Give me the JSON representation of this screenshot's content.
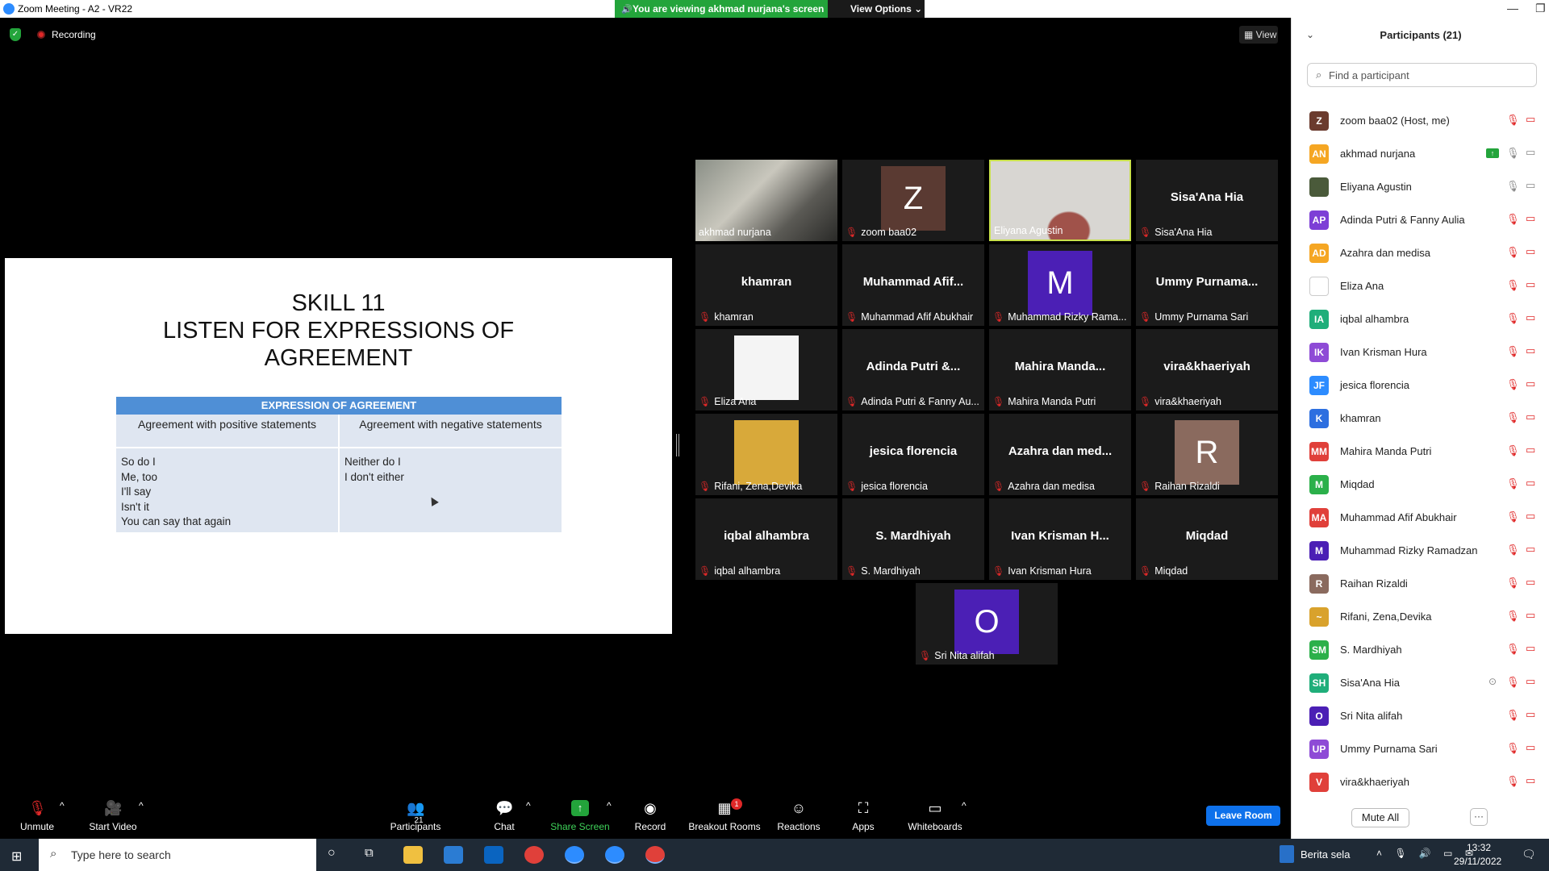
{
  "window": {
    "title": "Zoom Meeting - A2 - VR22",
    "banner": "You are viewing akhmad nurjana's screen",
    "view_options": "View Options ⌄",
    "controls": [
      "—",
      "❐",
      "✕"
    ]
  },
  "meeting": {
    "recording_label": "Recording",
    "view_label": "View"
  },
  "slide": {
    "title_line1": "SKILL 11",
    "title_line2": "LISTEN FOR EXPRESSIONS OF",
    "title_line3": "AGREEMENT",
    "table_header": "EXPRESSION OF AGREEMENT",
    "col1_header": "Agreement with positive statements",
    "col2_header": "Agreement with negative statements",
    "col1_items": [
      "So do I",
      "Me, too",
      "I'll say",
      "Isn't it",
      "You can say that again"
    ],
    "col2_items": [
      "Neither do I",
      "I don't either"
    ]
  },
  "gallery": [
    {
      "label": "akhmad nurjana",
      "type": "photo",
      "muted": false
    },
    {
      "label": "zoom baa02",
      "type": "avatar",
      "initial": "Z",
      "color": "#5a3a32",
      "muted": true
    },
    {
      "label": "Eliyana Agustin",
      "type": "photo",
      "muted": false,
      "speaking": true
    },
    {
      "label": "Sisa'Ana Hia",
      "type": "name",
      "display": "Sisa'Ana Hia",
      "muted": true
    },
    {
      "label": "khamran",
      "type": "name",
      "display": "khamran",
      "muted": true
    },
    {
      "label": "Muhammad Afif Abukhair",
      "type": "name",
      "display": "Muhammad Afif...",
      "muted": true
    },
    {
      "label": "Muhammad Rizky Rama...",
      "type": "avatar",
      "initial": "M",
      "color": "#4b1fb5",
      "muted": true
    },
    {
      "label": "Ummy Purnama Sari",
      "type": "name",
      "display": "Ummy Purnama...",
      "muted": true
    },
    {
      "label": "Eliza Ana",
      "type": "photo",
      "muted": true
    },
    {
      "label": "Adinda Putri & Fanny Au...",
      "type": "name",
      "display": "Adinda Putri &...",
      "muted": true
    },
    {
      "label": "Mahira Manda Putri",
      "type": "name",
      "display": "Mahira Manda...",
      "muted": true
    },
    {
      "label": "vira&khaeriyah",
      "type": "name",
      "display": "vira&khaeriyah",
      "muted": true
    },
    {
      "label": "Rifani, Zena,Devika",
      "type": "photo",
      "muted": true
    },
    {
      "label": "jesica florencia",
      "type": "name",
      "display": "jesica florencia",
      "muted": true
    },
    {
      "label": "Azahra dan medisa",
      "type": "name",
      "display": "Azahra dan med...",
      "muted": true
    },
    {
      "label": "Raihan Rizaldi",
      "type": "avatar",
      "initial": "R",
      "color": "#8a6a5e",
      "muted": true
    },
    {
      "label": "iqbal alhambra",
      "type": "name",
      "display": "iqbal alhambra",
      "muted": true
    },
    {
      "label": "S. Mardhiyah",
      "type": "name",
      "display": "S. Mardhiyah",
      "muted": true
    },
    {
      "label": "Ivan Krisman Hura",
      "type": "name",
      "display": "Ivan Krisman H...",
      "muted": true
    },
    {
      "label": "Miqdad",
      "type": "name",
      "display": "Miqdad",
      "muted": true
    },
    {
      "label": "Sri Nita alifah",
      "type": "avatar",
      "initial": "O",
      "color": "#4b1fb5",
      "muted": true
    }
  ],
  "participants_panel": {
    "title": "Participants (21)",
    "search_placeholder": "Find a participant",
    "mute_all": "Mute All",
    "more": "···",
    "list": [
      {
        "initials": "Z",
        "name": "zoom baa02 (Host, me)",
        "color": "#6b3b2e",
        "mic": "muted",
        "cam": "off"
      },
      {
        "initials": "AN",
        "name": "akhmad nurjana",
        "color": "#f5a623",
        "mic": "on",
        "cam": "on",
        "sharing": true
      },
      {
        "initials": "",
        "name": "Eliyana Agustin",
        "color": "#4a5a3a",
        "mic": "on",
        "cam": "on"
      },
      {
        "initials": "AP",
        "name": "Adinda Putri & Fanny Aulia",
        "color": "#7d3fd6",
        "mic": "muted",
        "cam": "off"
      },
      {
        "initials": "AD",
        "name": "Azahra dan medisa",
        "color": "#f5a623",
        "mic": "muted",
        "cam": "off"
      },
      {
        "initials": "",
        "name": "Eliza Ana",
        "color": "#ffffff",
        "mic": "muted",
        "cam": "off"
      },
      {
        "initials": "IA",
        "name": "iqbal alhambra",
        "color": "#1fae7a",
        "mic": "muted",
        "cam": "off"
      },
      {
        "initials": "IK",
        "name": "Ivan Krisman Hura",
        "color": "#8e4bd6",
        "mic": "muted",
        "cam": "off"
      },
      {
        "initials": "JF",
        "name": "jesica florencia",
        "color": "#2d8cff",
        "mic": "muted",
        "cam": "off"
      },
      {
        "initials": "K",
        "name": "khamran",
        "color": "#2d6fe0",
        "mic": "muted",
        "cam": "off"
      },
      {
        "initials": "MM",
        "name": "Mahira Manda Putri",
        "color": "#e0403a",
        "mic": "muted",
        "cam": "off"
      },
      {
        "initials": "M",
        "name": "Miqdad",
        "color": "#2bb04a",
        "mic": "muted",
        "cam": "off"
      },
      {
        "initials": "MA",
        "name": "Muhammad Afif Abukhair",
        "color": "#e0403a",
        "mic": "muted",
        "cam": "off"
      },
      {
        "initials": "M",
        "name": "Muhammad Rizky Ramadzan",
        "color": "#4b1fb5",
        "mic": "muted",
        "cam": "off"
      },
      {
        "initials": "R",
        "name": "Raihan Rizaldi",
        "color": "#8a6a5e",
        "mic": "muted",
        "cam": "off"
      },
      {
        "initials": "~",
        "name": "Rifani, Zena,Devika",
        "color": "#d9a22c",
        "mic": "muted",
        "cam": "off"
      },
      {
        "initials": "SM",
        "name": "S. Mardhiyah",
        "color": "#2bb04a",
        "mic": "muted",
        "cam": "off"
      },
      {
        "initials": "SH",
        "name": "Sisa'Ana Hia",
        "color": "#1fae7a",
        "mic": "muted",
        "cam": "off",
        "spotlight": true
      },
      {
        "initials": "O",
        "name": "Sri Nita alifah",
        "color": "#4b1fb5",
        "mic": "muted",
        "cam": "off"
      },
      {
        "initials": "UP",
        "name": "Ummy Purnama Sari",
        "color": "#8e4bd6",
        "mic": "muted",
        "cam": "off"
      },
      {
        "initials": "V",
        "name": "vira&khaeriyah",
        "color": "#e0403a",
        "mic": "muted",
        "cam": "off"
      }
    ]
  },
  "toolbar": {
    "unmute": "Unmute",
    "start_video": "Start Video",
    "participants": "Participants",
    "participants_count": "21",
    "chat": "Chat",
    "share_screen": "Share Screen",
    "record": "Record",
    "breakout_rooms": "Breakout Rooms",
    "breakout_badge": "1",
    "reactions": "Reactions",
    "apps": "Apps",
    "whiteboards": "Whiteboards",
    "leave": "Leave Room"
  },
  "taskbar": {
    "search_placeholder": "Type here to search",
    "weather_text": "Berita sela",
    "time": "13:32",
    "date": "29/11/2022"
  }
}
